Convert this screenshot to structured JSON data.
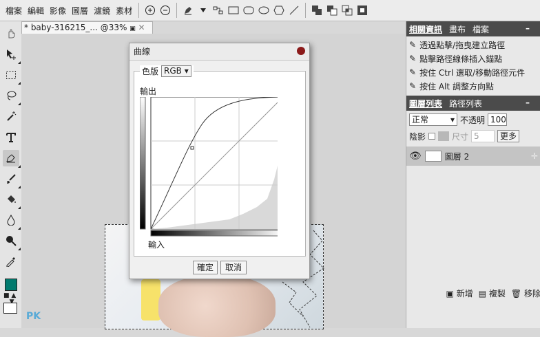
{
  "menu": [
    "檔案",
    "編輯",
    "影像",
    "圖層",
    "濾鏡",
    "素材"
  ],
  "document": {
    "tab_title": "* baby-316215_... @33%",
    "close": "✕"
  },
  "dialog": {
    "title": "曲線",
    "channel_label": "色版",
    "channel_value": "RGB",
    "output_label": "輸出",
    "input_label": "輸入",
    "ok": "確定",
    "cancel": "取消"
  },
  "right_panel": {
    "tabs": [
      "相關資訊",
      "畫布",
      "檔案"
    ],
    "info": [
      "透過點擊/拖曳建立路徑",
      "點擊路徑線條插入錨點",
      "按住 Ctrl 選取/移動路徑元件",
      "按住 Alt 調整方向點"
    ],
    "layer_tabs": [
      "圖層列表",
      "路徑列表"
    ],
    "blend_mode": "正常",
    "opacity_label": "不透明",
    "opacity_value": "100",
    "shadow_label": "陰影",
    "size_label": "尺寸",
    "size_value": "5",
    "more": "更多",
    "layer_name": "圖層 2",
    "bottom": [
      "新增",
      "複製",
      "移除"
    ]
  },
  "watermark": "PK",
  "colors": {
    "foreground": "#007a6e",
    "background": "#ffffff",
    "dialog_close": "#8b1a1a"
  }
}
